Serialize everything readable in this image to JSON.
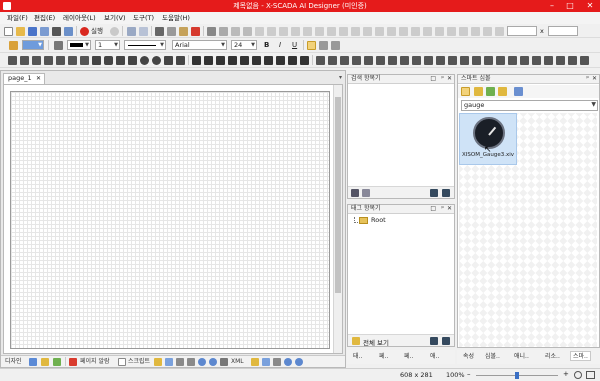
{
  "window": {
    "title": "제목없음 - X-SCADA AI Designer (미인증)",
    "minimize": "–",
    "maximize": "□",
    "close": "✕"
  },
  "menu": [
    "파일(F)",
    "편집(E)",
    "레이아웃(L)",
    "보기(V)",
    "도구(T)",
    "도움말(H)"
  ],
  "toolbar1": {
    "run_label": "실행",
    "width_field": "",
    "height_field": "",
    "size_sep": "x"
  },
  "toolbar2": {
    "line_width": "1",
    "font_name": "Arial",
    "font_size": "24",
    "bold": "B",
    "italic": "I",
    "underline": "U"
  },
  "document": {
    "tab_label": "page_1",
    "tab_close": "✕"
  },
  "bottom_tabs": {
    "design": "디자인",
    "page_list": "페이지 알람",
    "script": "스크립트",
    "xml": "XML"
  },
  "panels": {
    "search_top": {
      "title": "검색 항목기"
    },
    "tag_search": {
      "title": "태그 항목기",
      "tree_root": "Root",
      "view_all": "전체 보기"
    },
    "smart_symbol": {
      "title": "스마트 심볼",
      "search_value": "gauge",
      "item_label": "XISOM_Gauge3.xiv"
    }
  },
  "middle_tabs": [
    "태..",
    "페..",
    "페..",
    "애.."
  ],
  "right_tabs": [
    "속성",
    "심볼..",
    "애니..",
    "리소..",
    "스마.."
  ],
  "status": {
    "canvas_size": "608 x 281",
    "zoom": "100%",
    "zoom_level": 1.0,
    "zoom_minus": "–",
    "zoom_plus": "+"
  }
}
